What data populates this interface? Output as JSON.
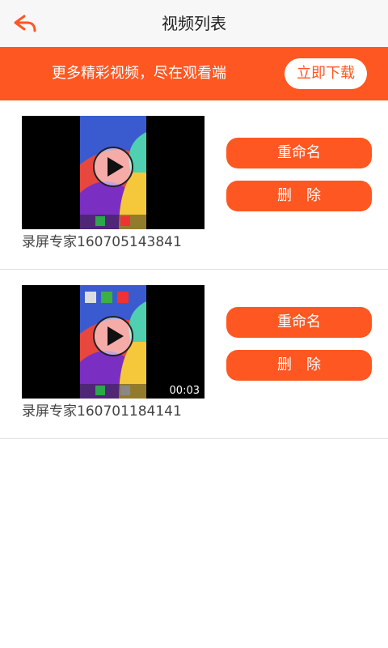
{
  "header": {
    "title": "视频列表",
    "back_icon": "back-arrow-icon"
  },
  "banner": {
    "text": "更多精彩视频，尽在观看端",
    "download_label": "立即下载"
  },
  "videos": [
    {
      "name": "录屏专家160705143841",
      "duration": "",
      "rename_label": "重命名",
      "delete_label": "删　除"
    },
    {
      "name": "录屏专家160701184141",
      "duration": "00:03",
      "rename_label": "重命名",
      "delete_label": "删　除"
    }
  ],
  "colors": {
    "accent": "#ff5722",
    "topbar": "#f7f7f7"
  }
}
